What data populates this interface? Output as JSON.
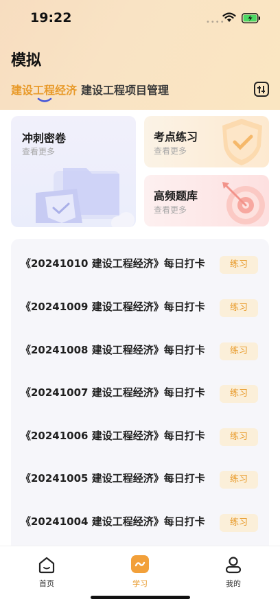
{
  "status_bar": {
    "time": "19:22"
  },
  "page": {
    "title": "模拟"
  },
  "tabs": [
    {
      "label": "建设工程经济",
      "active": true
    },
    {
      "label": "建设工程项目管理",
      "active": false
    }
  ],
  "cards": {
    "sprint": {
      "title": "冲刺密卷",
      "subtitle": "查看更多"
    },
    "key_points": {
      "title": "考点练习",
      "subtitle": "查看更多"
    },
    "high_freq": {
      "title": "高频题库",
      "subtitle": "查看更多"
    }
  },
  "practice_list": {
    "button_label": "练习",
    "items": [
      "《20241010 建设工程经济》每日打卡",
      "《20241009 建设工程经济》每日打卡",
      "《20241008 建设工程经济》每日打卡",
      "《20241007 建设工程经济》每日打卡",
      "《20241006 建设工程经济》每日打卡",
      "《20241005 建设工程经济》每日打卡",
      "《20241004 建设工程经济》每日打卡"
    ]
  },
  "tabbar": {
    "items": [
      {
        "label": "首页",
        "icon": "home-icon",
        "active": false
      },
      {
        "label": "学习",
        "icon": "study-icon",
        "active": true
      },
      {
        "label": "我的",
        "icon": "profile-icon",
        "active": false
      }
    ]
  },
  "colors": {
    "accent": "#e89a2a",
    "header_bg": "#f8e0c2",
    "list_bg": "#f6f6fa",
    "button_bg": "#fbefd9"
  }
}
